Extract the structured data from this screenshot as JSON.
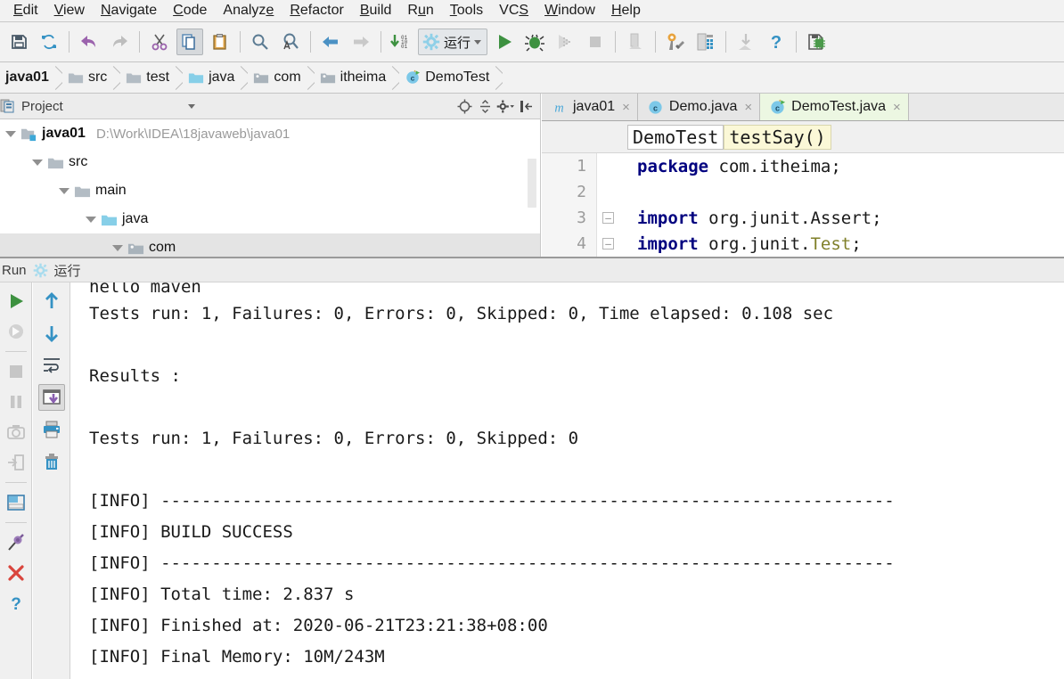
{
  "menubar": {
    "items": [
      {
        "label": "Edit",
        "mn": 0
      },
      {
        "label": "View",
        "mn": 0
      },
      {
        "label": "Navigate",
        "mn": 0
      },
      {
        "label": "Code",
        "mn": 0
      },
      {
        "label": "Analyze",
        "mn": 6
      },
      {
        "label": "Refactor",
        "mn": 0
      },
      {
        "label": "Build",
        "mn": 0
      },
      {
        "label": "Run",
        "mn": 1
      },
      {
        "label": "Tools",
        "mn": 0
      },
      {
        "label": "VCS",
        "mn": 2
      },
      {
        "label": "Window",
        "mn": 0
      },
      {
        "label": "Help",
        "mn": 0
      }
    ]
  },
  "toolbar": {
    "save_icon": "save-icon",
    "sync_icon": "sync-icon",
    "undo_icon": "undo-icon",
    "redo_icon": "redo-icon",
    "cut_icon": "cut-icon",
    "copy_icon": "copy-icon",
    "paste_icon": "paste-icon",
    "find_icon": "find-icon",
    "replace_icon": "find-replace-icon",
    "back_icon": "navigate-back-icon",
    "forward_icon": "navigate-forward-icon",
    "update_icon": "update-project-icon",
    "run_config_name": "运行",
    "run_icon": "run-icon",
    "debug_icon": "debug-icon",
    "coverage_icon": "run-coverage-icon",
    "stop_icon": "stop-icon",
    "profile_icon": "profiler-icon",
    "settings_icon": "settings-icon",
    "structure_icon": "project-structure-icon",
    "sdk_icon": "sdk-manager-icon",
    "help_icon": "help-icon",
    "memory_icon": "memory-indicator-icon"
  },
  "breadcrumb": {
    "items": [
      {
        "label": "java01",
        "icon": "module-icon",
        "bold": true
      },
      {
        "label": "src",
        "icon": "folder-icon",
        "bold": false
      },
      {
        "label": "test",
        "icon": "folder-icon",
        "bold": false
      },
      {
        "label": "java",
        "icon": "source-folder-icon",
        "bold": false
      },
      {
        "label": "com",
        "icon": "package-icon",
        "bold": false
      },
      {
        "label": "itheima",
        "icon": "package-icon",
        "bold": false
      },
      {
        "label": "DemoTest",
        "icon": "test-class-icon",
        "bold": false
      }
    ]
  },
  "project_panel": {
    "title": "Project",
    "dropdown_icon": "chevron-down-icon",
    "tools": [
      "locate-icon",
      "collapse-all-icon",
      "settings-gear-icon",
      "hide-panel-icon"
    ],
    "tree": [
      {
        "label": "java01",
        "path": "D:\\Work\\IDEA\\18javaweb\\java01",
        "indent": 0,
        "icon": "module-icon",
        "bold": true,
        "expanded": true,
        "selected": false
      },
      {
        "label": "src",
        "path": "",
        "indent": 1,
        "icon": "folder-icon",
        "bold": false,
        "expanded": true,
        "selected": false
      },
      {
        "label": "main",
        "path": "",
        "indent": 2,
        "icon": "folder-icon",
        "bold": false,
        "expanded": true,
        "selected": false
      },
      {
        "label": "java",
        "path": "",
        "indent": 3,
        "icon": "source-folder-icon",
        "bold": false,
        "expanded": true,
        "selected": false
      },
      {
        "label": "com",
        "path": "",
        "indent": 4,
        "icon": "package-icon",
        "bold": false,
        "expanded": true,
        "selected": true
      }
    ]
  },
  "editor": {
    "tabs": [
      {
        "label": "java01",
        "icon": "maven-pom-icon",
        "active": false
      },
      {
        "label": "Demo.java",
        "icon": "java-class-icon",
        "active": false
      },
      {
        "label": "DemoTest.java",
        "icon": "java-test-class-icon",
        "active": true
      }
    ],
    "close_glyph": "×",
    "crumb_class": "DemoTest",
    "crumb_method": "testSay()",
    "lines": [
      {
        "num": "1",
        "fold": false,
        "tokens": [
          {
            "t": "package",
            "c": "kw"
          },
          {
            "t": " com.itheima;",
            "c": "plain"
          }
        ]
      },
      {
        "num": "2",
        "fold": false,
        "tokens": []
      },
      {
        "num": "3",
        "fold": true,
        "tokens": [
          {
            "t": "import",
            "c": "kw"
          },
          {
            "t": " org.junit.Assert;",
            "c": "plain"
          }
        ]
      },
      {
        "num": "4",
        "fold": true,
        "tokens": [
          {
            "t": "import",
            "c": "kw"
          },
          {
            "t": " org.junit.",
            "c": "plain"
          },
          {
            "t": "Test",
            "c": "typ"
          },
          {
            "t": ";",
            "c": "plain"
          }
        ]
      }
    ]
  },
  "run_window": {
    "header_label": "Run",
    "config_icon": "run-config-gear-icon",
    "config_name": "运行",
    "side_left_icons": [
      "rerun-icon",
      "rerun-failed-icon",
      "stop-icon",
      "pause-icon",
      "dump-threads-icon",
      "export-icon",
      "layout-toggle-icon",
      "pin-tab-icon",
      "close-icon",
      "help-icon"
    ],
    "side_right_icons": [
      "up-arrow-icon",
      "down-arrow-icon",
      "soft-wrap-icon",
      "scroll-to-end-icon",
      "print-icon",
      "trash-icon"
    ],
    "console_lines": [
      {
        "text": "hello maven",
        "clipped": true
      },
      {
        "text": "Tests run: 1, Failures: 0, Errors: 0, Skipped: 0, Time elapsed: 0.108 sec",
        "clipped": false
      },
      {
        "text": "",
        "clipped": false
      },
      {
        "text": "Results :",
        "clipped": false
      },
      {
        "text": "",
        "clipped": false
      },
      {
        "text": "Tests run: 1, Failures: 0, Errors: 0, Skipped: 0",
        "clipped": false
      },
      {
        "text": "",
        "clipped": false
      },
      {
        "text": "[INFO] ------------------------------------------------------------------------",
        "clipped": false
      },
      {
        "text": "[INFO] BUILD SUCCESS",
        "clipped": false
      },
      {
        "text": "[INFO] ------------------------------------------------------------------------",
        "clipped": false
      },
      {
        "text": "[INFO] Total time: 2.837 s",
        "clipped": false
      },
      {
        "text": "[INFO] Finished at: 2020-06-21T23:21:38+08:00",
        "clipped": false
      },
      {
        "text": "[INFO] Final Memory: 10M/243M",
        "clipped": false
      }
    ]
  },
  "colors": {
    "accent_green": "#4caf50",
    "accent_blue": "#3592c4",
    "keyword": "#00007f",
    "type": "#80802a",
    "active_tab_bg": "#ecf7e2",
    "chip_highlight": "#fbf8d7"
  }
}
